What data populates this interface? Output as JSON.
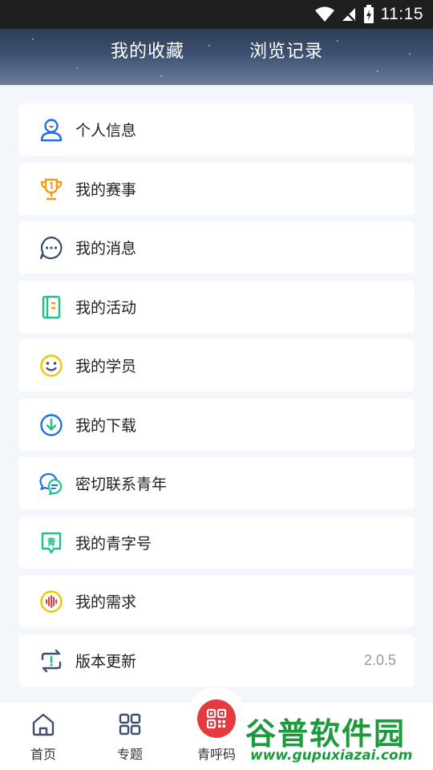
{
  "status_bar": {
    "time": "11:15",
    "icons": [
      "wifi-icon",
      "no-signal-icon",
      "battery-icon"
    ]
  },
  "header": {
    "tabs": [
      {
        "label": "我的收藏"
      },
      {
        "label": "浏览记录"
      }
    ]
  },
  "menu": {
    "items": [
      {
        "label": "个人信息",
        "icon": "user-icon",
        "color": "#1e6fe8"
      },
      {
        "label": "我的赛事",
        "icon": "trophy-icon",
        "color": "#f29b13"
      },
      {
        "label": "我的消息",
        "icon": "message-icon",
        "color": "#3d4e6e"
      },
      {
        "label": "我的活动",
        "icon": "notebook-icon",
        "color": "#1fc08a"
      },
      {
        "label": "我的学员",
        "icon": "smile-icon",
        "color": "#f5c400"
      },
      {
        "label": "我的下载",
        "icon": "download-icon",
        "color": "#1e6fe8"
      },
      {
        "label": "密切联系青年",
        "icon": "chat-bubbles-icon",
        "color": "#1e6fe8"
      },
      {
        "label": "我的青字号",
        "icon": "qing-badge-icon",
        "color": "#1fc08a"
      },
      {
        "label": "我的需求",
        "icon": "voice-wave-icon",
        "color": "#f5c400"
      },
      {
        "label": "版本更新",
        "icon": "refresh-icon",
        "color": "#3d4e6e",
        "value": "2.0.5"
      }
    ]
  },
  "bottom_nav": {
    "items": [
      {
        "label": "首页",
        "icon": "home-icon"
      },
      {
        "label": "专题",
        "icon": "grid-icon"
      },
      {
        "label": "青呼码",
        "icon": "qr-code-icon",
        "color": "#e63a3f"
      }
    ]
  },
  "watermark": {
    "title": "谷普软件园",
    "url": "www.gupuxiazai.com"
  }
}
